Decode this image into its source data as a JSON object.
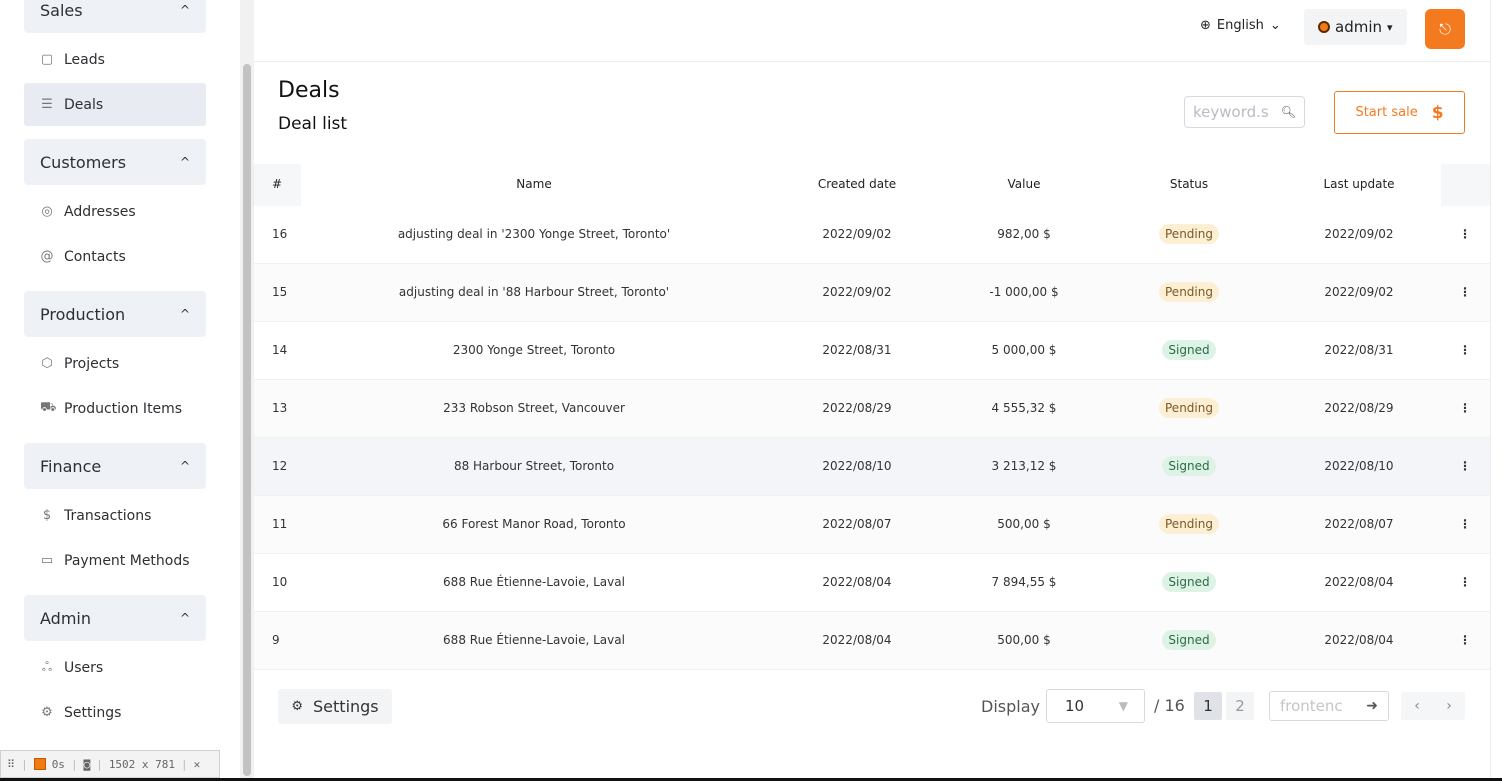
{
  "sidebar": {
    "sections": [
      {
        "label": "Sales",
        "items": [
          {
            "label": "Leads",
            "icon": "book-icon",
            "glyph": "▢"
          },
          {
            "label": "Deals",
            "icon": "list-icon",
            "glyph": "☰",
            "active": true
          }
        ]
      },
      {
        "label": "Customers",
        "items": [
          {
            "label": "Addresses",
            "icon": "location-icon",
            "glyph": "◎"
          },
          {
            "label": "Contacts",
            "icon": "at-icon",
            "glyph": "@"
          }
        ]
      },
      {
        "label": "Production",
        "items": [
          {
            "label": "Projects",
            "icon": "cube-icon",
            "glyph": "⬡"
          },
          {
            "label": "Production Items",
            "icon": "truck-icon",
            "glyph": "⛟"
          }
        ]
      },
      {
        "label": "Finance",
        "items": [
          {
            "label": "Transactions",
            "icon": "dollar-icon",
            "glyph": "$"
          },
          {
            "label": "Payment Methods",
            "icon": "card-icon",
            "glyph": "▭"
          }
        ]
      },
      {
        "label": "Admin",
        "items": [
          {
            "label": "Users",
            "icon": "user-icon",
            "glyph": "ஃ"
          },
          {
            "label": "Settings",
            "icon": "gear-icon",
            "glyph": "⚙"
          }
        ]
      }
    ]
  },
  "devtools": {
    "time": "0s",
    "size": "1502 x 781"
  },
  "topbar": {
    "language": "English",
    "user": "admin"
  },
  "page": {
    "title": "Deals",
    "subtitle": "Deal list",
    "search_placeholder": "keyword.s",
    "start_sale_label": "Start sale",
    "start_sale_symbol": "$"
  },
  "table": {
    "columns": [
      "#",
      "Name",
      "Created date",
      "Value",
      "Status",
      "Last update"
    ],
    "rows": [
      {
        "id": "16",
        "name": "adjusting deal in '2300 Yonge Street, Toronto'",
        "created": "2022/09/02",
        "value": "982,00 $",
        "status": "Pending",
        "updated": "2022/09/02"
      },
      {
        "id": "15",
        "name": "adjusting deal in '88 Harbour Street, Toronto'",
        "created": "2022/09/02",
        "value": "-1 000,00 $",
        "status": "Pending",
        "updated": "2022/09/02"
      },
      {
        "id": "14",
        "name": "2300 Yonge Street, Toronto",
        "created": "2022/08/31",
        "value": "5 000,00 $",
        "status": "Signed",
        "updated": "2022/08/31"
      },
      {
        "id": "13",
        "name": "233 Robson Street, Vancouver",
        "created": "2022/08/29",
        "value": "4 555,32 $",
        "status": "Pending",
        "updated": "2022/08/29"
      },
      {
        "id": "12",
        "name": "88 Harbour Street, Toronto",
        "created": "2022/08/10",
        "value": "3 213,12 $",
        "status": "Signed",
        "updated": "2022/08/10"
      },
      {
        "id": "11",
        "name": "66 Forest Manor Road, Toronto",
        "created": "2022/08/07",
        "value": "500,00 $",
        "status": "Pending",
        "updated": "2022/08/07"
      },
      {
        "id": "10",
        "name": "688 Rue Étienne-Lavoie, Laval",
        "created": "2022/08/04",
        "value": "7 894,55 $",
        "status": "Signed",
        "updated": "2022/08/04"
      },
      {
        "id": "9",
        "name": "688 Rue Étienne-Lavoie, Laval",
        "created": "2022/08/04",
        "value": "500,00 $",
        "status": "Signed",
        "updated": "2022/08/04"
      }
    ]
  },
  "footer": {
    "settings_label": "Settings",
    "display_label": "Display",
    "page_size": "10",
    "total": "/ 16",
    "pages": [
      "1",
      "2"
    ],
    "current_page": "1",
    "jump_placeholder": "frontenc"
  }
}
